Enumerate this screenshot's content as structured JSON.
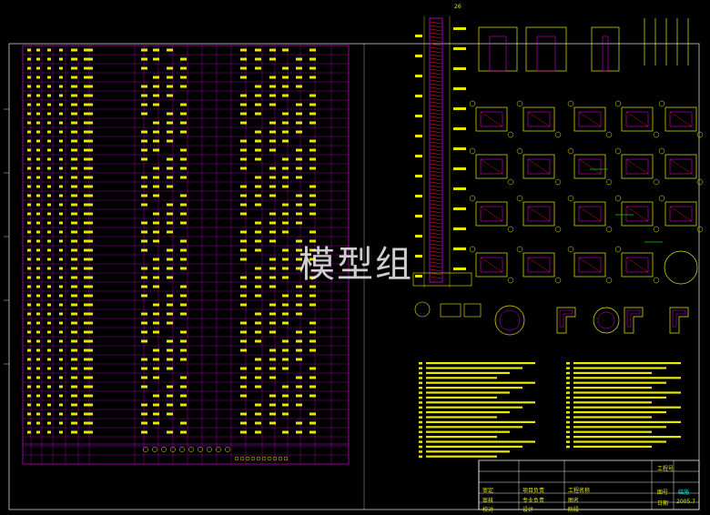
{
  "watermark": "模型组",
  "top_mark": "26",
  "title_block": {
    "labels": [
      "工程号",
      "图号",
      "日期"
    ],
    "values": [
      "结施",
      "2005.7"
    ],
    "left_labels": [
      "审定",
      "审核",
      "校对"
    ],
    "mid_labels": [
      "项目负责",
      "专业负责",
      "设计"
    ],
    "right_labels": [
      "工程名称",
      "图名",
      "阶段"
    ]
  },
  "colors": {
    "background": "#000000",
    "border": "#cfcfcf",
    "table_lines": "#d400d4",
    "table_text": "#e8e800",
    "detail_lines": "#e8e800",
    "detail_magenta": "#d400d4",
    "detail_green": "#00d400",
    "detail_red": "#ff2020",
    "detail_cyan": "#20e0e0"
  }
}
